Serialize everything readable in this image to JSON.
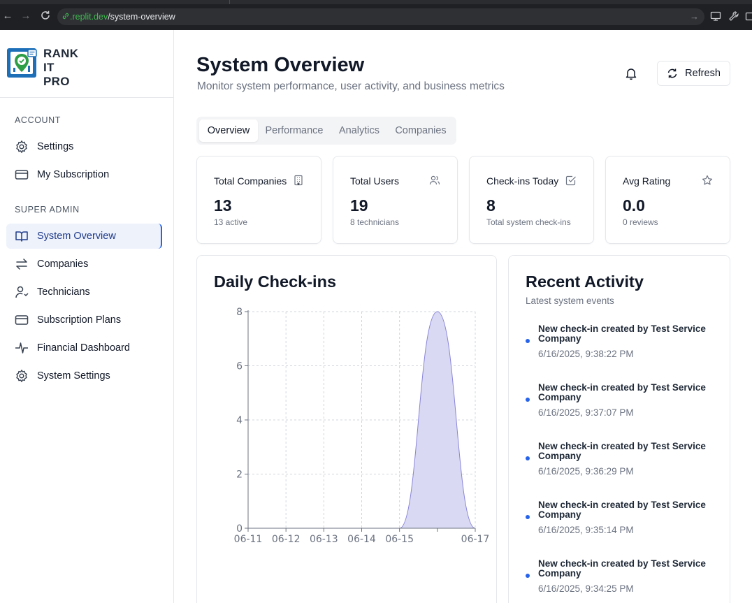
{
  "browser": {
    "url_host": ".replit.dev",
    "url_path": "/system-overview"
  },
  "sidebar": {
    "logo": {
      "line1": "RANK",
      "line2": "IT",
      "line3": "PRO"
    },
    "account_label": "ACCOUNT",
    "account_items": [
      {
        "label": "Settings",
        "icon": "gear-icon"
      },
      {
        "label": "My Subscription",
        "icon": "credit-card-icon"
      }
    ],
    "admin_label": "SUPER ADMIN",
    "admin_items": [
      {
        "label": "System Overview",
        "icon": "book-open-icon",
        "active": true
      },
      {
        "label": "Companies",
        "icon": "arrows-swap-icon"
      },
      {
        "label": "Technicians",
        "icon": "user-cog-icon"
      },
      {
        "label": "Subscription Plans",
        "icon": "credit-card-icon"
      },
      {
        "label": "Financial Dashboard",
        "icon": "pulse-icon"
      },
      {
        "label": "System Settings",
        "icon": "gear-icon"
      }
    ]
  },
  "header": {
    "title": "System Overview",
    "subtitle": "Monitor system performance, user activity, and business metrics",
    "refresh_label": "Refresh"
  },
  "tabs": [
    {
      "label": "Overview",
      "active": true
    },
    {
      "label": "Performance"
    },
    {
      "label": "Analytics"
    },
    {
      "label": "Companies"
    }
  ],
  "stats": [
    {
      "title": "Total Companies",
      "value": "13",
      "note": "13 active",
      "icon": "building-icon"
    },
    {
      "title": "Total Users",
      "value": "19",
      "note": "8 technicians",
      "icon": "users-icon"
    },
    {
      "title": "Check-ins Today",
      "value": "8",
      "note": "Total system check-ins",
      "icon": "check-square-icon"
    },
    {
      "title": "Avg Rating",
      "value": "0.0",
      "note": "0 reviews",
      "icon": "star-icon"
    }
  ],
  "daily_checkins": {
    "title": "Daily Check-ins"
  },
  "chart_data": {
    "type": "area",
    "x": [
      "06-11",
      "06-12",
      "06-13",
      "06-14",
      "06-15",
      "06-16",
      "06-17"
    ],
    "series": [
      {
        "values": [
          0,
          0,
          0,
          0,
          0,
          8,
          0
        ]
      }
    ],
    "x_tick_labels": [
      "06-11",
      "06-12",
      "06-13",
      "06-14",
      "06-15",
      "06-17"
    ],
    "y_ticks": [
      0,
      2,
      4,
      6,
      8
    ],
    "ylim": [
      0,
      8
    ],
    "grid": true,
    "fill_color": "#d9d9f3",
    "line_color": "#8884d8"
  },
  "recent_activity": {
    "title": "Recent Activity",
    "subtitle": "Latest system events",
    "items": [
      {
        "text": "New check-in created by Test Service Company",
        "time": "6/16/2025, 9:38:22 PM"
      },
      {
        "text": "New check-in created by Test Service Company",
        "time": "6/16/2025, 9:37:07 PM"
      },
      {
        "text": "New check-in created by Test Service Company",
        "time": "6/16/2025, 9:36:29 PM"
      },
      {
        "text": "New check-in created by Test Service Company",
        "time": "6/16/2025, 9:35:14 PM"
      },
      {
        "text": "New check-in created by Test Service Company",
        "time": "6/16/2025, 9:34:25 PM"
      }
    ]
  }
}
